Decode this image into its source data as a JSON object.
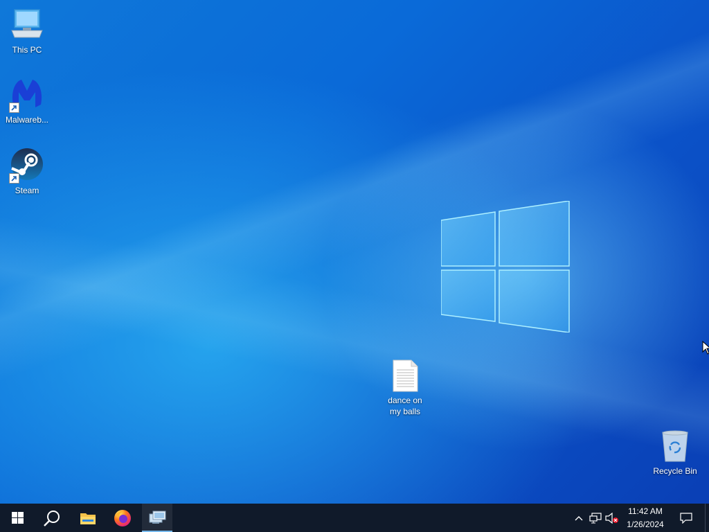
{
  "desktop": {
    "icons": [
      {
        "label": "This PC",
        "icon": "this-pc-icon"
      },
      {
        "label": "Malwareb...",
        "icon": "malwarebytes-icon"
      },
      {
        "label": "Steam",
        "icon": "steam-icon"
      },
      {
        "label": "dance on my balls",
        "icon": "text-document-icon"
      },
      {
        "label": "Recycle Bin",
        "icon": "recycle-bin-icon"
      }
    ]
  },
  "taskbar": {
    "start": "windows-start-icon",
    "search": "search-icon",
    "pinned": [
      "file-explorer-icon",
      "firefox-icon",
      "remote-desktop-icon"
    ],
    "active_app": "remote-desktop-icon",
    "tray": {
      "icons": [
        "chevron-up-icon",
        "network-icon",
        "volume-muted-icon"
      ],
      "time": "11:42 AM",
      "date": "1/26/2024",
      "notification": "action-center-icon"
    }
  },
  "colors": {
    "taskbar": "#101a2a",
    "accent": "#76b9ed",
    "desktop": "#0b6fd8"
  }
}
